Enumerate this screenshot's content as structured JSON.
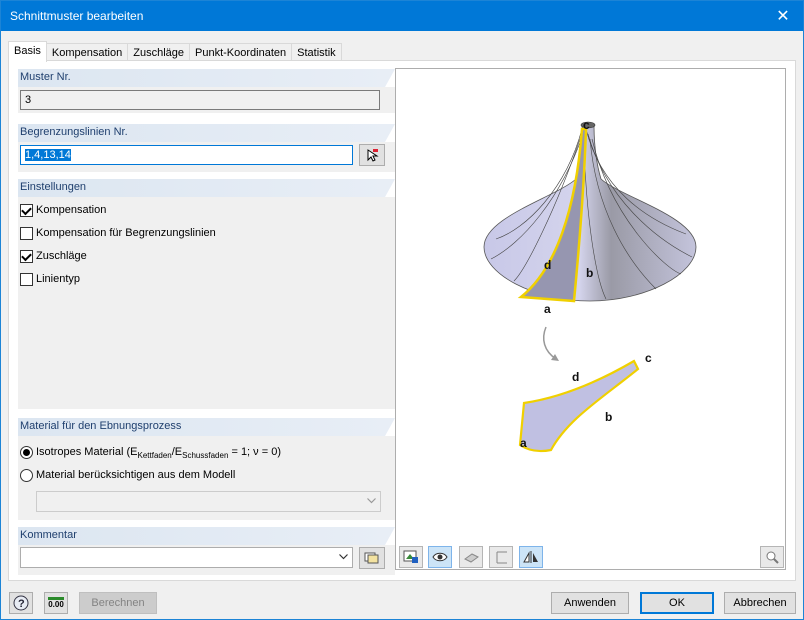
{
  "window": {
    "title": "Schnittmuster bearbeiten",
    "close_glyph": "✕"
  },
  "tabs": [
    {
      "label": "Basis",
      "active": true
    },
    {
      "label": "Kompensation",
      "active": false
    },
    {
      "label": "Zuschläge",
      "active": false
    },
    {
      "label": "Punkt-Koordinaten",
      "active": false
    },
    {
      "label": "Statistik",
      "active": false
    }
  ],
  "muster": {
    "header": "Muster Nr.",
    "value": "3"
  },
  "begrenzung": {
    "header": "Begrenzungslinien Nr.",
    "value": "1,4,13,14",
    "pick_icon": "pick-icon"
  },
  "einstellungen": {
    "header": "Einstellungen",
    "options": [
      {
        "label": "Kompensation",
        "checked": true
      },
      {
        "label": "Kompensation für Begrenzungslinien",
        "checked": false
      },
      {
        "label": "Zuschläge",
        "checked": true
      },
      {
        "label": "Linientyp",
        "checked": false
      }
    ]
  },
  "material": {
    "header": "Material für den Ebnungsprozess",
    "option1_prefix": "Isotropes Material (E",
    "option1_sub1": "Kettfaden",
    "option1_mid": "/E",
    "option1_sub2": "Schussfaden",
    "option1_suffix": " = 1; ν = 0)",
    "option1_checked": true,
    "option2": "Material berücksichtigen aus dem Modell",
    "option2_checked": false,
    "model_select": ""
  },
  "kommentar": {
    "header": "Kommentar",
    "value": ""
  },
  "preview": {
    "labels_top": {
      "c": "c",
      "d": "d",
      "b": "b",
      "a": "a"
    },
    "labels_flat": {
      "c": "c",
      "d": "d",
      "b": "b",
      "a": "a"
    },
    "colors": {
      "surface": "#c5c5e6",
      "edge_highlight": "#f0d000",
      "lines": "#404040"
    }
  },
  "footer": {
    "compute": "Berechnen",
    "apply": "Anwenden",
    "ok": "OK",
    "cancel": "Abbrechen",
    "units_value": "0.00"
  }
}
